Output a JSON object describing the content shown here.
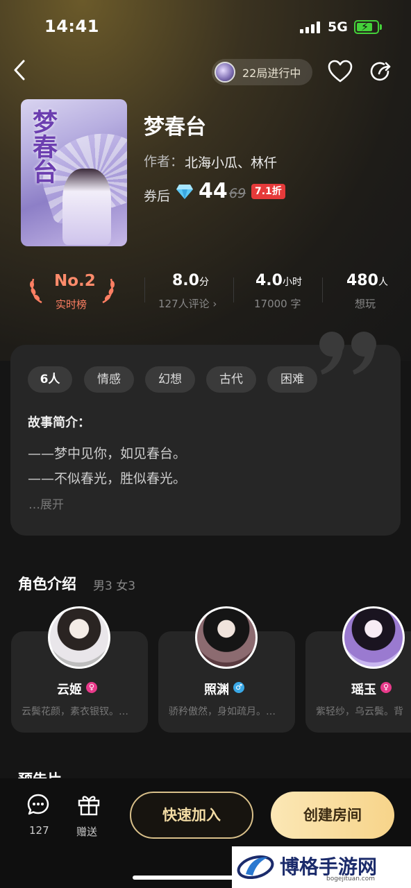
{
  "status_bar": {
    "time": "14:41",
    "network": "5G"
  },
  "header": {
    "live_text": "22局进行中"
  },
  "book": {
    "title": "梦春台",
    "author_label": "作者：",
    "authors": "北海小瓜、林仟",
    "price_label": "券后",
    "price_now": "44",
    "price_old": "69",
    "discount": "7.1折",
    "cover_art_text": "梦春台"
  },
  "stats": {
    "rank": {
      "value": "No.2",
      "label": "实时榜"
    },
    "score": {
      "value": "8.0",
      "unit": "分",
      "sub": "127人评论 ›"
    },
    "duration": {
      "value": "4.0",
      "unit": "小时",
      "sub": "17000 字"
    },
    "want": {
      "value": "480",
      "unit": "人",
      "sub": "想玩"
    }
  },
  "intro": {
    "tags": [
      "6人",
      "情感",
      "幻想",
      "古代",
      "困难"
    ],
    "title": "故事简介：",
    "lines": [
      "——梦中见你，如见春台。",
      "——不似春光，胜似春光。"
    ],
    "expand": "…展开"
  },
  "roles": {
    "title": "角色介绍",
    "count": "男3 女3",
    "items": [
      {
        "name": "云姬",
        "gender": "female",
        "desc": "云鬓花颜，素衣银钗。…"
      },
      {
        "name": "照渊",
        "gender": "male",
        "desc": "骄矜傲然，身如疏月。…"
      },
      {
        "name": "瑶玉",
        "gender": "female",
        "desc": "紫轻纱，乌云鬓。背"
      }
    ]
  },
  "next_section_title": "预告片",
  "bottom": {
    "comment_count": "127",
    "gift_label": "赠送",
    "join_label": "快速加入",
    "create_label": "创建房间"
  },
  "watermark": {
    "text": "博格手游网",
    "url": "bogejituan.com"
  },
  "colors": {
    "accent_gold": "#f7d48a",
    "rank_red": "#ff8b6b",
    "discount_red": "#e63a3a",
    "male_blue": "#3aa8e6",
    "female_pink": "#e83a8a"
  }
}
